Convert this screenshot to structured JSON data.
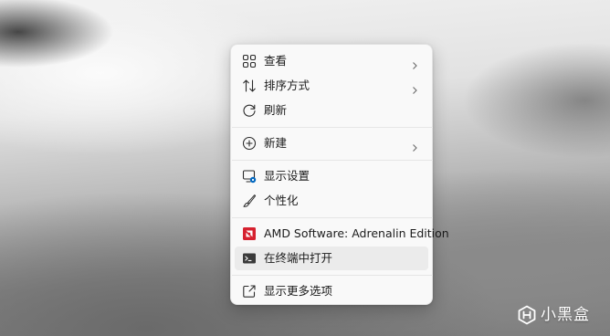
{
  "desktop": {
    "context_menu": {
      "items": [
        {
          "label": "查看",
          "icon": "view-grid-icon",
          "has_submenu": true
        },
        {
          "label": "排序方式",
          "icon": "sort-arrows-icon",
          "has_submenu": true
        },
        {
          "label": "刷新",
          "icon": "refresh-icon",
          "has_submenu": false
        },
        {
          "label": "新建",
          "icon": "new-plus-circle-icon",
          "has_submenu": true
        },
        {
          "label": "显示设置",
          "icon": "display-settings-icon",
          "has_submenu": false
        },
        {
          "label": "个性化",
          "icon": "brush-icon",
          "has_submenu": false
        },
        {
          "label": "AMD Software: Adrenalin Edition",
          "icon": "amd-logo-icon",
          "has_submenu": false
        },
        {
          "label": "在终端中打开",
          "icon": "terminal-icon",
          "has_submenu": false,
          "highlighted": true
        },
        {
          "label": "显示更多选项",
          "icon": "show-more-options-icon",
          "has_submenu": false
        }
      ]
    }
  },
  "watermark": {
    "text": "小黑盒",
    "icon": "xiaoheihe-logo-icon"
  },
  "colors": {
    "menu_background": "#f9f9f9",
    "hover_highlight": "#ebebeb",
    "amd_red": "#d6212f",
    "display_accent": "#0067c0"
  }
}
